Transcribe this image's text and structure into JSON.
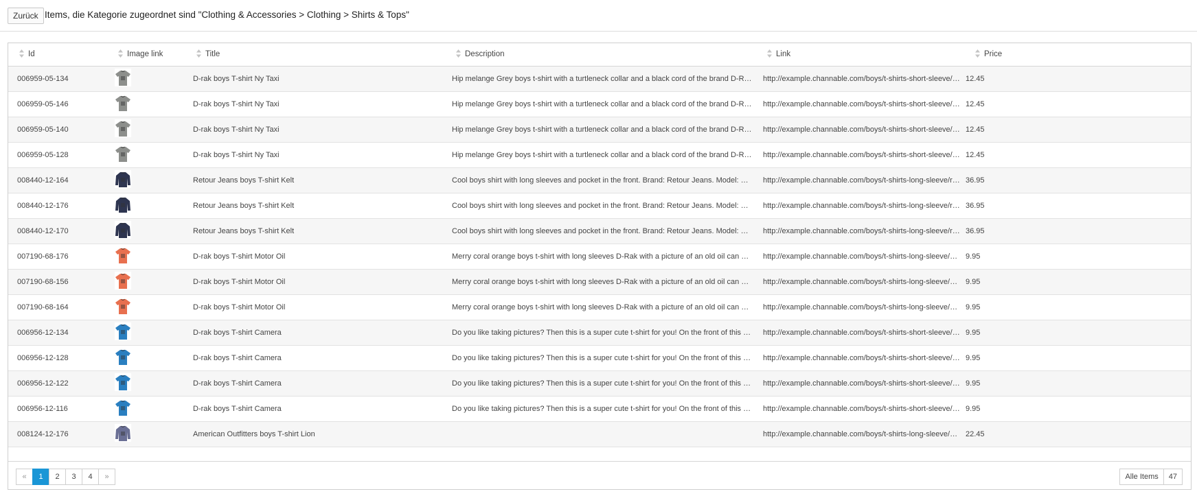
{
  "header": {
    "back_label": "Zurück",
    "title": "Items, die Kategorie zugeordnet sind \"Clothing & Accessories > Clothing > Shirts & Tops\""
  },
  "table": {
    "columns": [
      "Id",
      "Image link",
      "Title",
      "Description",
      "Link",
      "Price"
    ],
    "rows": [
      {
        "id": "006959-05-134",
        "image": "grey-taxi-tshirt",
        "title": "D-rak boys T-shirt Ny Taxi",
        "description": "Hip melange Grey boys t-shirt with a turtleneck collar and a black cord of the brand D-Rak. On the ...",
        "link": "http://example.channable.com/boys/t-shirts-short-sleeve/d-rak/...",
        "price": "12.45"
      },
      {
        "id": "006959-05-146",
        "image": "grey-taxi-tshirt",
        "title": "D-rak boys T-shirt Ny Taxi",
        "description": "Hip melange Grey boys t-shirt with a turtleneck collar and a black cord of the brand D-Rak. On the ...",
        "link": "http://example.channable.com/boys/t-shirts-short-sleeve/d-rak/...",
        "price": "12.45"
      },
      {
        "id": "006959-05-140",
        "image": "grey-taxi-tshirt",
        "title": "D-rak boys T-shirt Ny Taxi",
        "description": "Hip melange Grey boys t-shirt with a turtleneck collar and a black cord of the brand D-Rak. On the ...",
        "link": "http://example.channable.com/boys/t-shirts-short-sleeve/d-rak/...",
        "price": "12.45"
      },
      {
        "id": "006959-05-128",
        "image": "grey-taxi-tshirt",
        "title": "D-rak boys T-shirt Ny Taxi",
        "description": "Hip melange Grey boys t-shirt with a turtleneck collar and a black cord of the brand D-Rak. On the ...",
        "link": "http://example.channable.com/boys/t-shirts-short-sleeve/d-rak/...",
        "price": "12.45"
      },
      {
        "id": "008440-12-164",
        "image": "navy-longsleeve-shirt",
        "title": "Retour Jeans boys T-shirt Kelt",
        "description": "Cool boys shirt with long sleeves and pocket in the front. Brand: Retour Jeans. Model: Kelt. Colour...",
        "link": "http://example.channable.com/boys/t-shirts-long-sleeve/retour-...",
        "price": "36.95"
      },
      {
        "id": "008440-12-176",
        "image": "navy-longsleeve-shirt",
        "title": "Retour Jeans boys T-shirt Kelt",
        "description": "Cool boys shirt with long sleeves and pocket in the front. Brand: Retour Jeans. Model: Kelt. Colour...",
        "link": "http://example.channable.com/boys/t-shirts-long-sleeve/retour-...",
        "price": "36.95"
      },
      {
        "id": "008440-12-170",
        "image": "navy-longsleeve-shirt",
        "title": "Retour Jeans boys T-shirt Kelt",
        "description": "Cool boys shirt with long sleeves and pocket in the front. Brand: Retour Jeans. Model: Kelt. Colour...",
        "link": "http://example.channable.com/boys/t-shirts-long-sleeve/retour-...",
        "price": "36.95"
      },
      {
        "id": "007190-68-176",
        "image": "orange-motor-oil-shirt",
        "title": "D-rak boys T-shirt Motor Oil",
        "description": "Merry coral orange boys t-shirt with long sleeves D-Rak with a picture of an old oil can with 'five U...",
        "link": "http://example.channable.com/boys/t-shirts-long-sleeve/d-rak/...",
        "price": "9.95"
      },
      {
        "id": "007190-68-156",
        "image": "orange-motor-oil-shirt",
        "title": "D-rak boys T-shirt Motor Oil",
        "description": "Merry coral orange boys t-shirt with long sleeves D-Rak with a picture of an old oil can with 'five U...",
        "link": "http://example.channable.com/boys/t-shirts-long-sleeve/d-rak/...",
        "price": "9.95"
      },
      {
        "id": "007190-68-164",
        "image": "orange-motor-oil-shirt",
        "title": "D-rak boys T-shirt Motor Oil",
        "description": "Merry coral orange boys t-shirt with long sleeves D-Rak with a picture of an old oil can with 'five U...",
        "link": "http://example.channable.com/boys/t-shirts-long-sleeve/d-rak/...",
        "price": "9.95"
      },
      {
        "id": "006956-12-134",
        "image": "blue-camera-tshirt",
        "title": "D-rak boys T-shirt Camera",
        "description": "Do you like taking pictures? Then this is a super cute t-shirt for you! On the front of this t-shirt Blue...",
        "link": "http://example.channable.com/boys/t-shirts-short-sleeve/d-rak/...",
        "price": "9.95"
      },
      {
        "id": "006956-12-128",
        "image": "blue-camera-tshirt",
        "title": "D-rak boys T-shirt Camera",
        "description": "Do you like taking pictures? Then this is a super cute t-shirt for you! On the front of this t-shirt Blue...",
        "link": "http://example.channable.com/boys/t-shirts-short-sleeve/d-rak/...",
        "price": "9.95"
      },
      {
        "id": "006956-12-122",
        "image": "blue-camera-tshirt",
        "title": "D-rak boys T-shirt Camera",
        "description": "Do you like taking pictures? Then this is a super cute t-shirt for you! On the front of this t-shirt Blue...",
        "link": "http://example.channable.com/boys/t-shirts-short-sleeve/d-rak/...",
        "price": "9.95"
      },
      {
        "id": "006956-12-116",
        "image": "blue-camera-tshirt",
        "title": "D-rak boys T-shirt Camera",
        "description": "Do you like taking pictures? Then this is a super cute t-shirt for you! On the front of this t-shirt Blue...",
        "link": "http://example.channable.com/boys/t-shirts-short-sleeve/d-rak/...",
        "price": "9.95"
      },
      {
        "id": "008124-12-176",
        "image": "purple-lion-longsleeve",
        "title": "American Outfitters boys T-shirt Lion",
        "description": "",
        "link": "http://example.channable.com/boys/t-shirts-long-sleeve/ameri...",
        "price": "22.45"
      }
    ]
  },
  "pagination": {
    "prev": "«",
    "pages": [
      "1",
      "2",
      "3",
      "4"
    ],
    "active_page": "1",
    "next": "»"
  },
  "all_items": {
    "label": "Alle Items",
    "count": "47"
  },
  "colors": {
    "accent": "#1a96d6",
    "grey_shirt": "#8d8f8c",
    "navy_shirt": "#2e3550",
    "orange_shirt": "#e8704f",
    "blue_shirt": "#2a7fc0",
    "purple_shirt": "#6a6f94"
  }
}
